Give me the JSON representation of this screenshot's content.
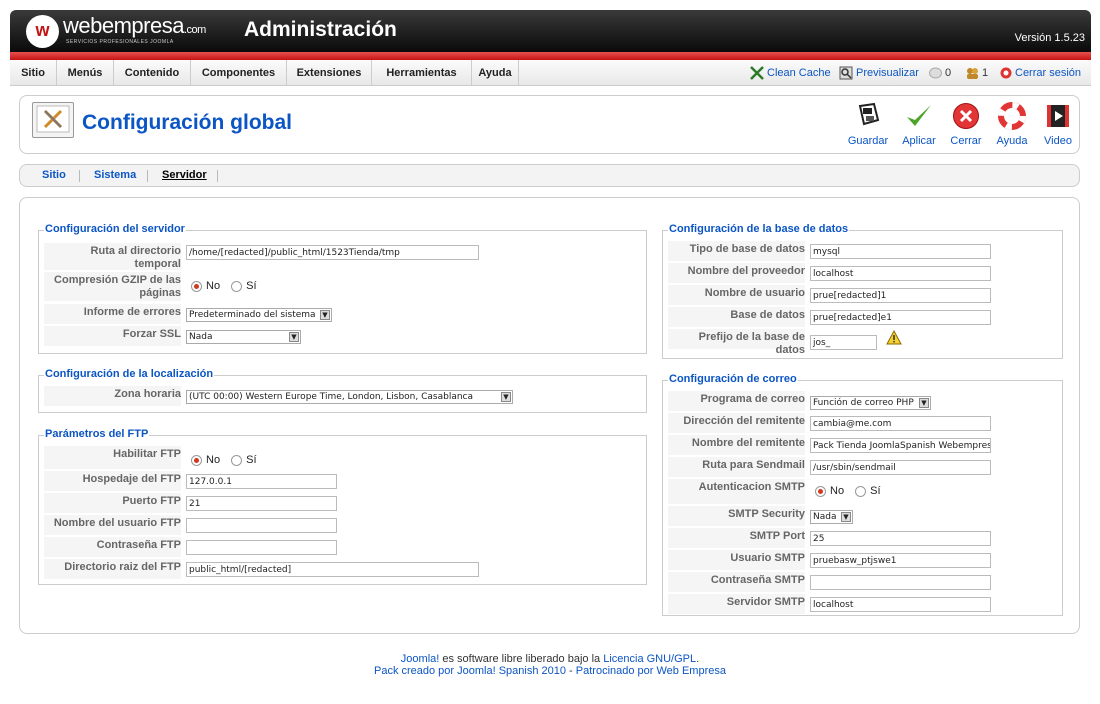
{
  "header": {
    "logo_mark": "w",
    "logo_name": "webempresa",
    "logo_suffix": ".com",
    "logo_tagline": "SERVICIOS PROFESIONALES JOOMLA",
    "title": "Administración",
    "version": "Versión 1.5.23"
  },
  "menu": {
    "items": [
      "Sitio",
      "Menús",
      "Contenido",
      "Componentes",
      "Extensiones",
      "Herramientas",
      "Ayuda"
    ],
    "status": {
      "clean_cache": "Clean Cache",
      "preview": "Previsualizar",
      "messages": "0",
      "users": "1",
      "logout": "Cerrar sesión"
    }
  },
  "toolbar": {
    "title": "Configuración global",
    "buttons": {
      "save": "Guardar",
      "apply": "Aplicar",
      "close": "Cerrar",
      "help": "Ayuda",
      "video": "Video"
    }
  },
  "tabs": [
    "Sitio",
    "Sistema",
    "Servidor"
  ],
  "server": {
    "legend": "Configuración del servidor",
    "tmp_label": "Ruta al directorio temporal",
    "tmp_value": "/home/[redacted]/public_html/1523Tienda/tmp",
    "gzip_label": "Compresión GZIP de las páginas",
    "error_label": "Informe de errores",
    "error_value": "Predeterminado del sistema",
    "ssl_label": "Forzar SSL",
    "ssl_value": "Nada"
  },
  "locale": {
    "legend": "Configuración de la localización",
    "tz_label": "Zona horaria",
    "tz_value": "(UTC 00:00) Western Europe Time, London, Lisbon, Casablanca"
  },
  "ftp": {
    "legend": "Parámetros del FTP",
    "enable_label": "Habilitar FTP",
    "host_label": "Hospedaje del FTP",
    "host_value": "127.0.0.1",
    "port_label": "Puerto FTP",
    "port_value": "21",
    "user_label": "Nombre del usuario FTP",
    "user_value": "",
    "pass_label": "Contraseña FTP",
    "pass_value": "",
    "root_label": "Directorio raiz del FTP",
    "root_value": "public_html/[redacted]"
  },
  "radio": {
    "no": "No",
    "yes": "Sí"
  },
  "database": {
    "legend": "Configuración de la base de datos",
    "type_label": "Tipo de base de datos",
    "type_value": "mysql",
    "host_label": "Nombre del proveedor",
    "host_value": "localhost",
    "user_label": "Nombre de usuario",
    "user_value": "prue[redacted]1",
    "db_label": "Base de datos",
    "db_value": "prue[redacted]e1",
    "prefix_label": "Prefijo de la base de datos",
    "prefix_value": "jos_"
  },
  "mail": {
    "legend": "Configuración de correo",
    "mailer_label": "Programa de correo",
    "mailer_value": "Función de correo PHP",
    "from_label": "Dirección del remitente",
    "from_value": "cambia@me.com",
    "fromname_label": "Nombre del remitente",
    "fromname_value": "Pack Tienda JoomlaSpanish Webempresa",
    "sendmail_label": "Ruta para Sendmail",
    "sendmail_value": "/usr/sbin/sendmail",
    "auth_label": "Autenticacion SMTP",
    "security_label": "SMTP Security",
    "security_value": "Nada",
    "port_label": "SMTP Port",
    "port_value": "25",
    "user_label": "Usuario SMTP",
    "user_value": "pruebasw_ptjswe1",
    "pass_label": "Contraseña SMTP",
    "pass_value": "",
    "server_label": "Servidor SMTP",
    "server_value": "localhost"
  },
  "footer": {
    "line1_link1": "Joomla!",
    "line1_text": " es software libre liberado bajo la ",
    "line1_link2": "Licencia GNU/GPL",
    "line1_end": ".",
    "line2_link1": "Pack creado por Joomla! Spanish 2010",
    "line2_sep": " - ",
    "line2_link2": "Patrocinado por Web Empresa"
  }
}
